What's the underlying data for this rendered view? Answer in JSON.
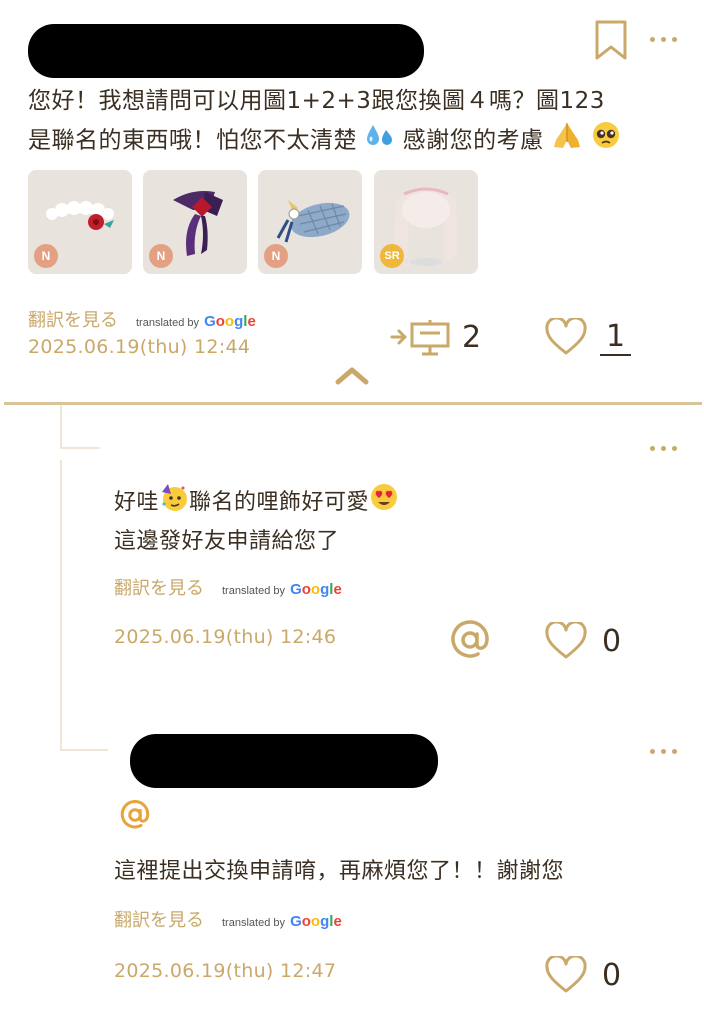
{
  "post": {
    "text_line1": "您好！我想請問可以用圖1+2+3跟您換圖４嗎？圖123",
    "text_line2a": "是聯名的東西哦！怕您不太清楚",
    "text_line2b": "感謝您的考慮",
    "items": [
      {
        "rarity": "N",
        "name": "white frilly headband with red flower"
      },
      {
        "rarity": "N",
        "name": "purple ribbon bow"
      },
      {
        "rarity": "N",
        "name": "blue plaid beret"
      },
      {
        "rarity": "SR",
        "name": "pale pink long hair"
      }
    ],
    "translate_label": "翻訳を見る",
    "translated_by": "translated by",
    "google": "Google",
    "date": "2025.06.19(thu) 12:44",
    "share_count": "2",
    "like_count": "1",
    "accent_color": "#c9a86a"
  },
  "replies": [
    {
      "line1a": "好哇",
      "line1b": "聯名的哩飾好可愛",
      "line2": "這邊發好友申請給您了",
      "translate_label": "翻訳を見る",
      "translated_by": "translated by",
      "google": "Google",
      "date": "2025.06.19(thu) 12:46",
      "like_count": "0"
    },
    {
      "line1": "這裡提出交換申請唷，再麻煩您了！！謝謝您",
      "translate_label": "翻訳を見る",
      "translated_by": "translated by",
      "google": "Google",
      "date": "2025.06.19(thu) 12:47",
      "like_count": "0"
    }
  ],
  "icons": {
    "bookmark": "bookmark-icon",
    "more": "more-options-icon",
    "share": "share-icon",
    "heart": "heart-icon",
    "mention": "at-mention-icon",
    "collapse": "chevron-up-icon"
  }
}
